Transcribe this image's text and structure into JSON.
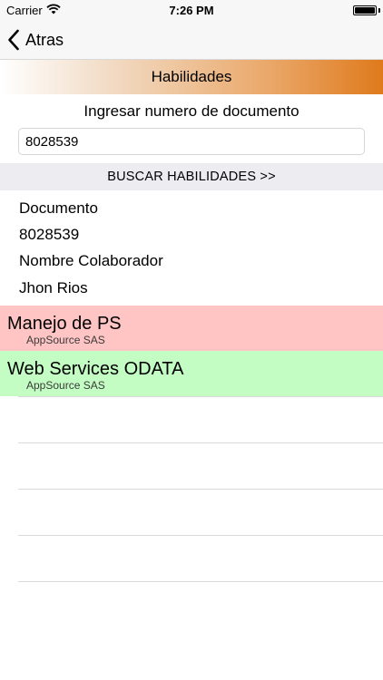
{
  "status_bar": {
    "carrier": "Carrier",
    "time": "7:26 PM",
    "battery_level_percent": 100
  },
  "nav_bar": {
    "back_label": "Atras",
    "back_icon": "chevron-left-icon"
  },
  "header": {
    "title": "Habilidades",
    "gradient_colors": [
      "#ffffff",
      "#f2dcc6",
      "#eaa86a",
      "#df7a1c"
    ]
  },
  "search": {
    "label": "Ingresar numero de documento",
    "input_value": "8028539",
    "button_label": "BUSCAR HABILIDADES >>"
  },
  "employee": {
    "document_label": "Documento",
    "document_value": "8028539",
    "name_label": "Nombre Colaborador",
    "name_value": "Jhon Rios"
  },
  "skills": [
    {
      "title": "Manejo de PS",
      "subtitle": "AppSource SAS",
      "color": "#ffc4c4"
    },
    {
      "title": "Web Services ODATA",
      "subtitle": "AppSource SAS",
      "color": "#c3fdc3"
    }
  ]
}
